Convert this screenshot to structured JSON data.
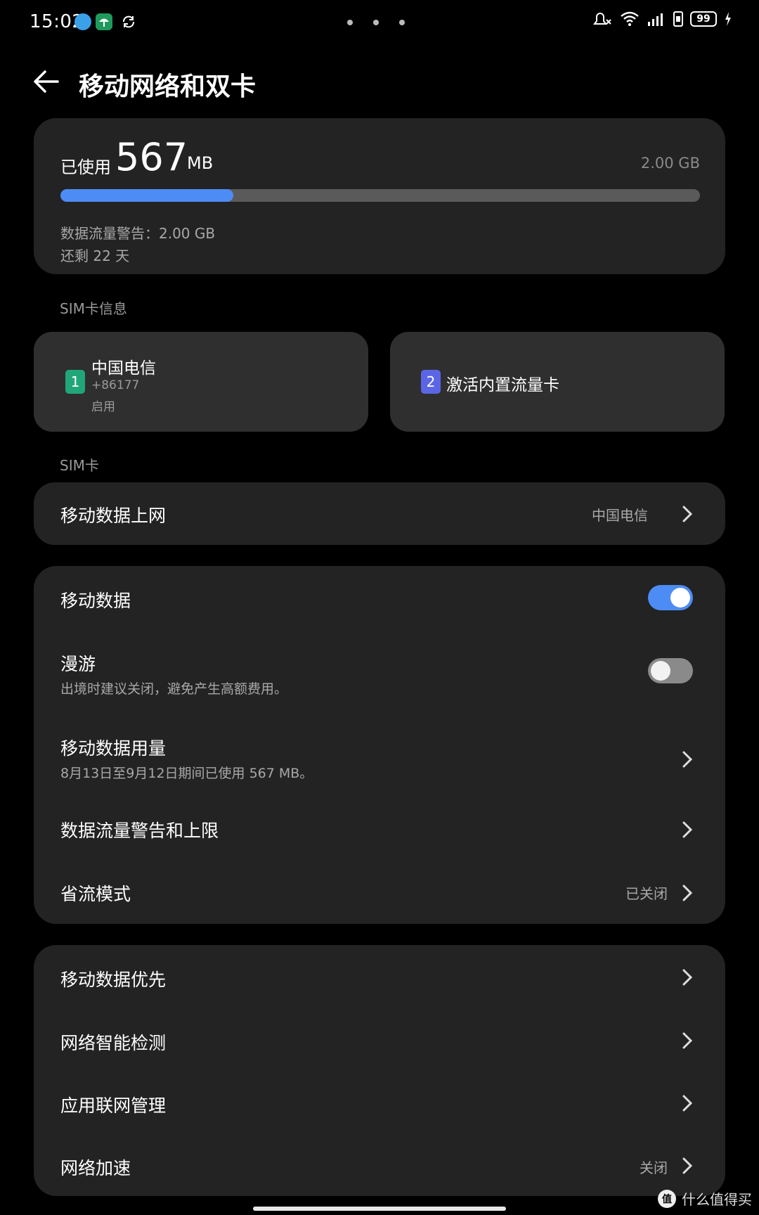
{
  "status_bar": {
    "time": "15:02",
    "battery": "99"
  },
  "header": {
    "title": "移动网络和双卡"
  },
  "usage": {
    "used_label": "已使用",
    "used_value": "567",
    "used_unit": "MB",
    "total": "2.00 GB",
    "progress_fraction": 0.27,
    "warning_text": "数据流量警告：2.00 GB",
    "days_left_text": "还剩 22 天"
  },
  "sim_info": {
    "section_label": "SIM卡信息",
    "sim1": {
      "slot": "1",
      "carrier": "中国电信",
      "number": "+86177",
      "status": "启用"
    },
    "sim2": {
      "slot": "2",
      "label": "激活内置流量卡"
    }
  },
  "sim_section": {
    "section_label": "SIM卡",
    "mobile_data_net": {
      "title": "移动数据上网",
      "value": "中国电信"
    }
  },
  "data_settings": {
    "mobile_data": {
      "title": "移动数据",
      "enabled": true
    },
    "roaming": {
      "title": "漫游",
      "subtitle": "出境时建议关闭，避免产生高额费用。",
      "enabled": false
    },
    "data_usage": {
      "title": "移动数据用量",
      "subtitle": "8月13日至9月12日期间已使用 567 MB。"
    },
    "limits": {
      "title": "数据流量警告和上限"
    },
    "saver": {
      "title": "省流模式",
      "value": "已关闭"
    }
  },
  "network_settings": {
    "priority": {
      "title": "移动数据优先"
    },
    "detect": {
      "title": "网络智能检测"
    },
    "app_net": {
      "title": "应用联网管理"
    },
    "accel": {
      "title": "网络加速",
      "value": "关闭"
    }
  },
  "watermark": {
    "logo": "值",
    "text": "什么值得买"
  },
  "colors": {
    "accent": "#4d8cf5",
    "card": "#232323",
    "sim1": "#21a67a",
    "sim2": "#5b66e6"
  }
}
